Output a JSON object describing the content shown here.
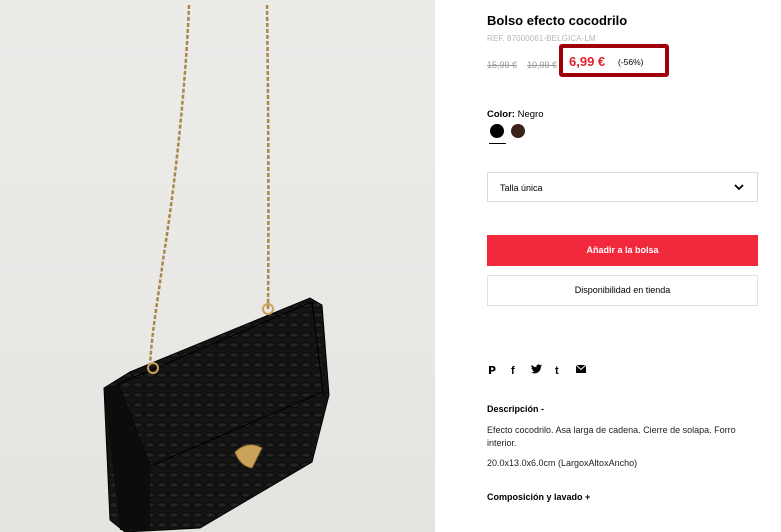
{
  "product": {
    "title": "Bolso efecto cocodrilo",
    "ref": "REF. 87000061-BELGICA-LM",
    "old_price_1": "15,99 €",
    "old_price_2": "10,99 €",
    "price": "6,99 €",
    "discount": "(-56%)"
  },
  "color": {
    "label": "Color:",
    "value": "Negro",
    "swatches": [
      {
        "name": "black",
        "hex": "#000000"
      },
      {
        "name": "brown",
        "hex": "#3b2417"
      }
    ]
  },
  "size": {
    "selected": "Talla única"
  },
  "actions": {
    "add_to_bag": "Añadir a la bolsa",
    "store_availability": "Disponibilidad en tienda"
  },
  "share": {
    "pinterest": "P",
    "facebook": "f",
    "twitter": "🐦",
    "tumblr": "t",
    "mail": "✉"
  },
  "description": {
    "title": "Descripción -",
    "text": "Efecto cocodrilo. Asa larga de cadena. Cierre de solapa. Forro interior.",
    "dimensions": "20.0x13.0x6.0cm (LargoxAltoxAncho)"
  },
  "composition": {
    "title": "Composición y lavado +"
  },
  "colors": {
    "accent_red": "#f2293c",
    "highlight_border": "#a0000a",
    "price_red": "#e3202f"
  }
}
